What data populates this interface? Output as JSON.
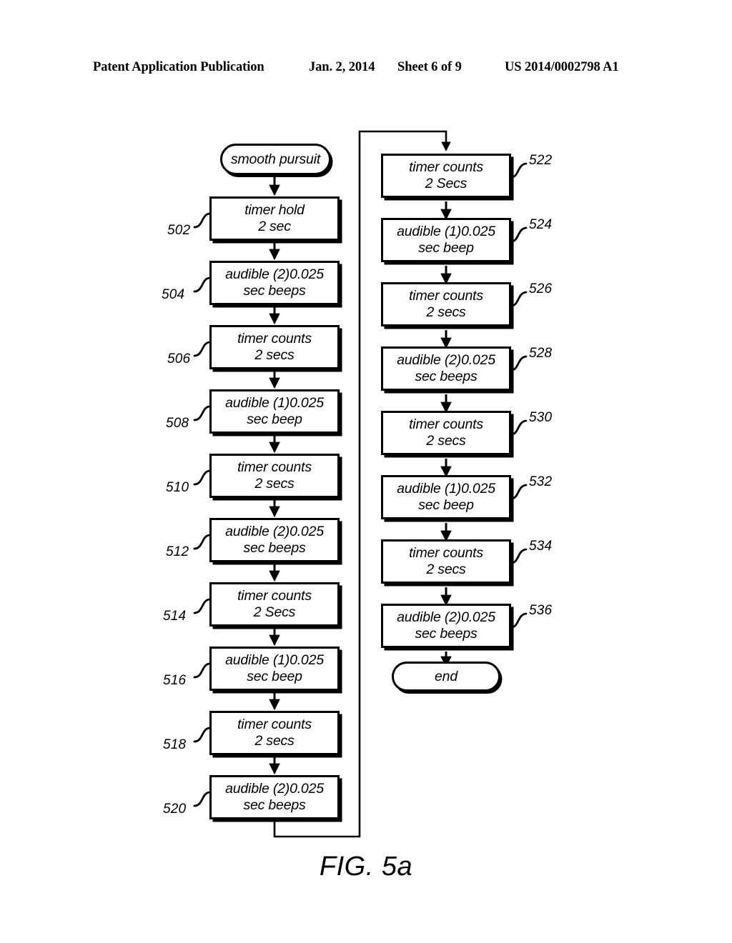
{
  "header": {
    "publication": "Patent Application Publication",
    "date": "Jan. 2, 2014",
    "sheet": "Sheet 6 of 9",
    "patent_number": "US 2014/0002798 A1"
  },
  "figure": {
    "caption": "FIG. 5a",
    "colors": {
      "ink": "#000000",
      "paper": "#ffffff"
    },
    "start_node": {
      "ref": "",
      "lines": [
        "smooth pursuit"
      ]
    },
    "end_node": {
      "ref": "",
      "lines": [
        "end"
      ]
    },
    "left_column": [
      {
        "ref": "502",
        "lines": [
          "timer hold",
          "2 sec"
        ]
      },
      {
        "ref": "504",
        "lines": [
          "audible (2)0.025",
          "sec beeps"
        ]
      },
      {
        "ref": "506",
        "lines": [
          "timer counts",
          "2 secs"
        ]
      },
      {
        "ref": "508",
        "lines": [
          "audible (1)0.025",
          "sec beep"
        ]
      },
      {
        "ref": "510",
        "lines": [
          "timer counts",
          "2 secs"
        ]
      },
      {
        "ref": "512",
        "lines": [
          "audible (2)0.025",
          "sec beeps"
        ]
      },
      {
        "ref": "514",
        "lines": [
          "timer counts",
          "2 Secs"
        ]
      },
      {
        "ref": "516",
        "lines": [
          "audible (1)0.025",
          "sec beep"
        ]
      },
      {
        "ref": "518",
        "lines": [
          "timer counts",
          "2 secs"
        ]
      },
      {
        "ref": "520",
        "lines": [
          "audible (2)0.025",
          "sec beeps"
        ]
      }
    ],
    "right_column": [
      {
        "ref": "522",
        "lines": [
          "timer counts",
          "2 Secs"
        ]
      },
      {
        "ref": "524",
        "lines": [
          "audible (1)0.025",
          "sec beep"
        ]
      },
      {
        "ref": "526",
        "lines": [
          "timer counts",
          "2 secs"
        ]
      },
      {
        "ref": "528",
        "lines": [
          "audible (2)0.025",
          "sec beeps"
        ]
      },
      {
        "ref": "530",
        "lines": [
          "timer counts",
          "2 secs"
        ]
      },
      {
        "ref": "532",
        "lines": [
          "audible (1)0.025",
          "sec beep"
        ]
      },
      {
        "ref": "534",
        "lines": [
          "timer counts",
          "2 secs"
        ]
      },
      {
        "ref": "536",
        "lines": [
          "audible (2)0.025",
          "sec beeps"
        ]
      }
    ]
  }
}
